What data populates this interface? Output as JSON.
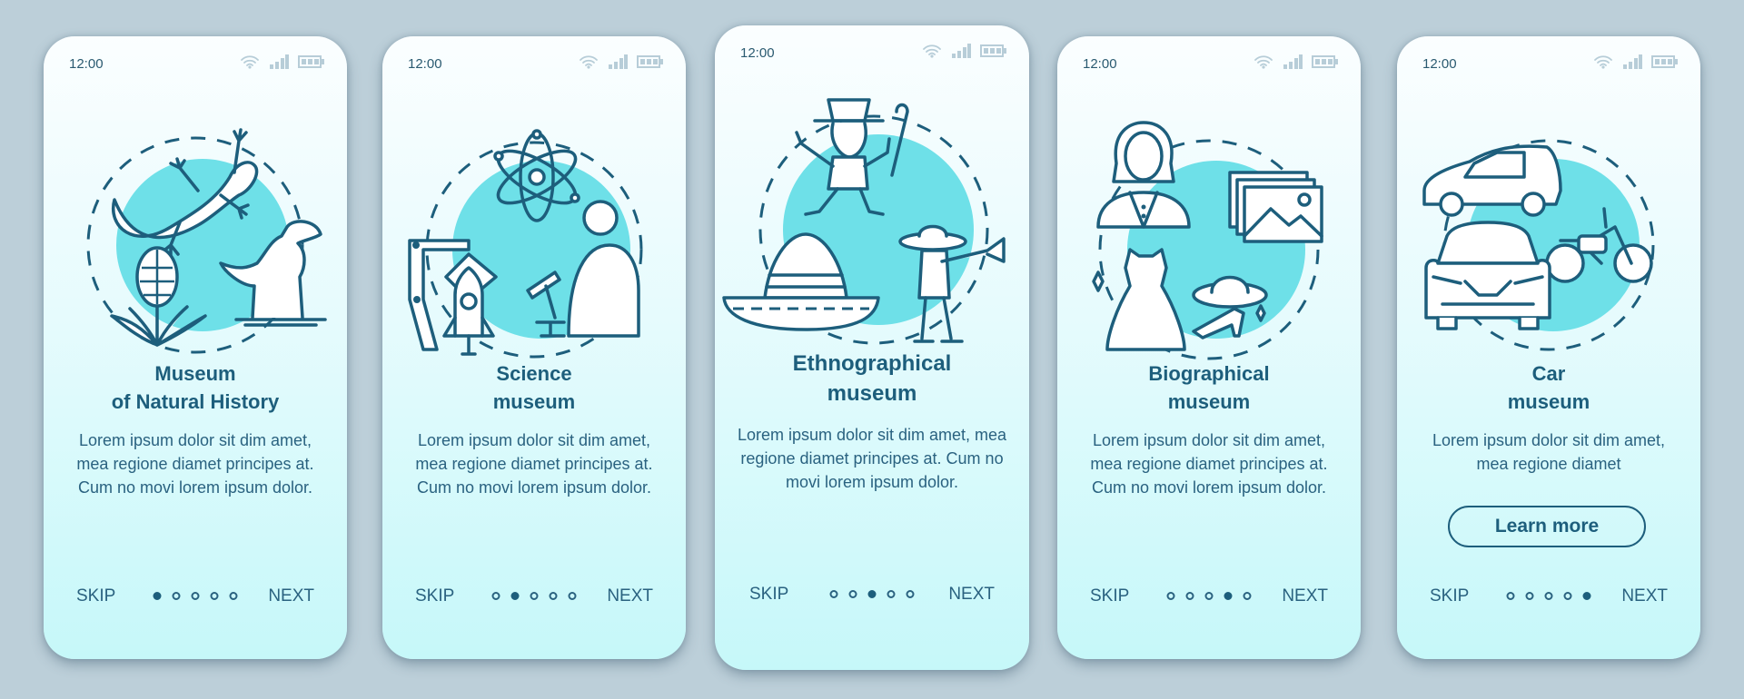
{
  "colors": {
    "background": "#bccfd9",
    "accent_line": "#1d5e7c",
    "blob": "#6ee0e8",
    "status_icon": "#b7cdd8"
  },
  "cards": [
    {
      "time": "12:00",
      "title_line1": "Museum",
      "title_line2": "of Natural History",
      "body": "Lorem ipsum dolor sit dim amet, mea regione diamet principes at. Cum no movi lorem ipsum dolor.",
      "illustration": [
        "lizard-icon",
        "dinosaur-icon",
        "plant-icon"
      ],
      "skip": "SKIP",
      "next": "NEXT",
      "page": 1,
      "pages": 5
    },
    {
      "time": "12:00",
      "title_line1": "Science",
      "title_line2": "museum",
      "body": "Lorem ipsum dolor sit dim amet, mea regione diamet principes at. Cum no movi lorem ipsum dolor.",
      "illustration": [
        "atom-icon",
        "robot-arm-icon",
        "rocket-icon",
        "microscope-scientist-icon"
      ],
      "skip": "SKIP",
      "next": "NEXT",
      "page": 2,
      "pages": 5
    },
    {
      "time": "12:00",
      "title_line1": "Ethnographical",
      "title_line2": "museum",
      "body": "Lorem ipsum dolor sit dim amet, mea regione diamet principes at. Cum no movi lorem ipsum dolor.",
      "illustration": [
        "leprechaun-icon",
        "sombrero-icon",
        "mariachi-trumpeter-icon"
      ],
      "skip": "SKIP",
      "next": "NEXT",
      "page": 3,
      "pages": 5
    },
    {
      "time": "12:00",
      "title_line1": "Biographical",
      "title_line2": "museum",
      "body": "Lorem ipsum dolor sit dim amet, mea regione diamet principes at. Cum no movi lorem ipsum dolor.",
      "illustration": [
        "woman-portrait-icon",
        "photos-icon",
        "dress-icon",
        "hat-icon",
        "heels-icon"
      ],
      "skip": "SKIP",
      "next": "NEXT",
      "page": 4,
      "pages": 5
    },
    {
      "time": "12:00",
      "title_line1": "Car",
      "title_line2": "museum",
      "body": "Lorem ipsum dolor sit dim amet, mea regione diamet",
      "button": "Learn more",
      "illustration": [
        "hatchback-car-icon",
        "motorcycle-icon",
        "sedan-front-icon"
      ],
      "skip": "SKIP",
      "next": "NEXT",
      "page": 5,
      "pages": 5
    }
  ]
}
